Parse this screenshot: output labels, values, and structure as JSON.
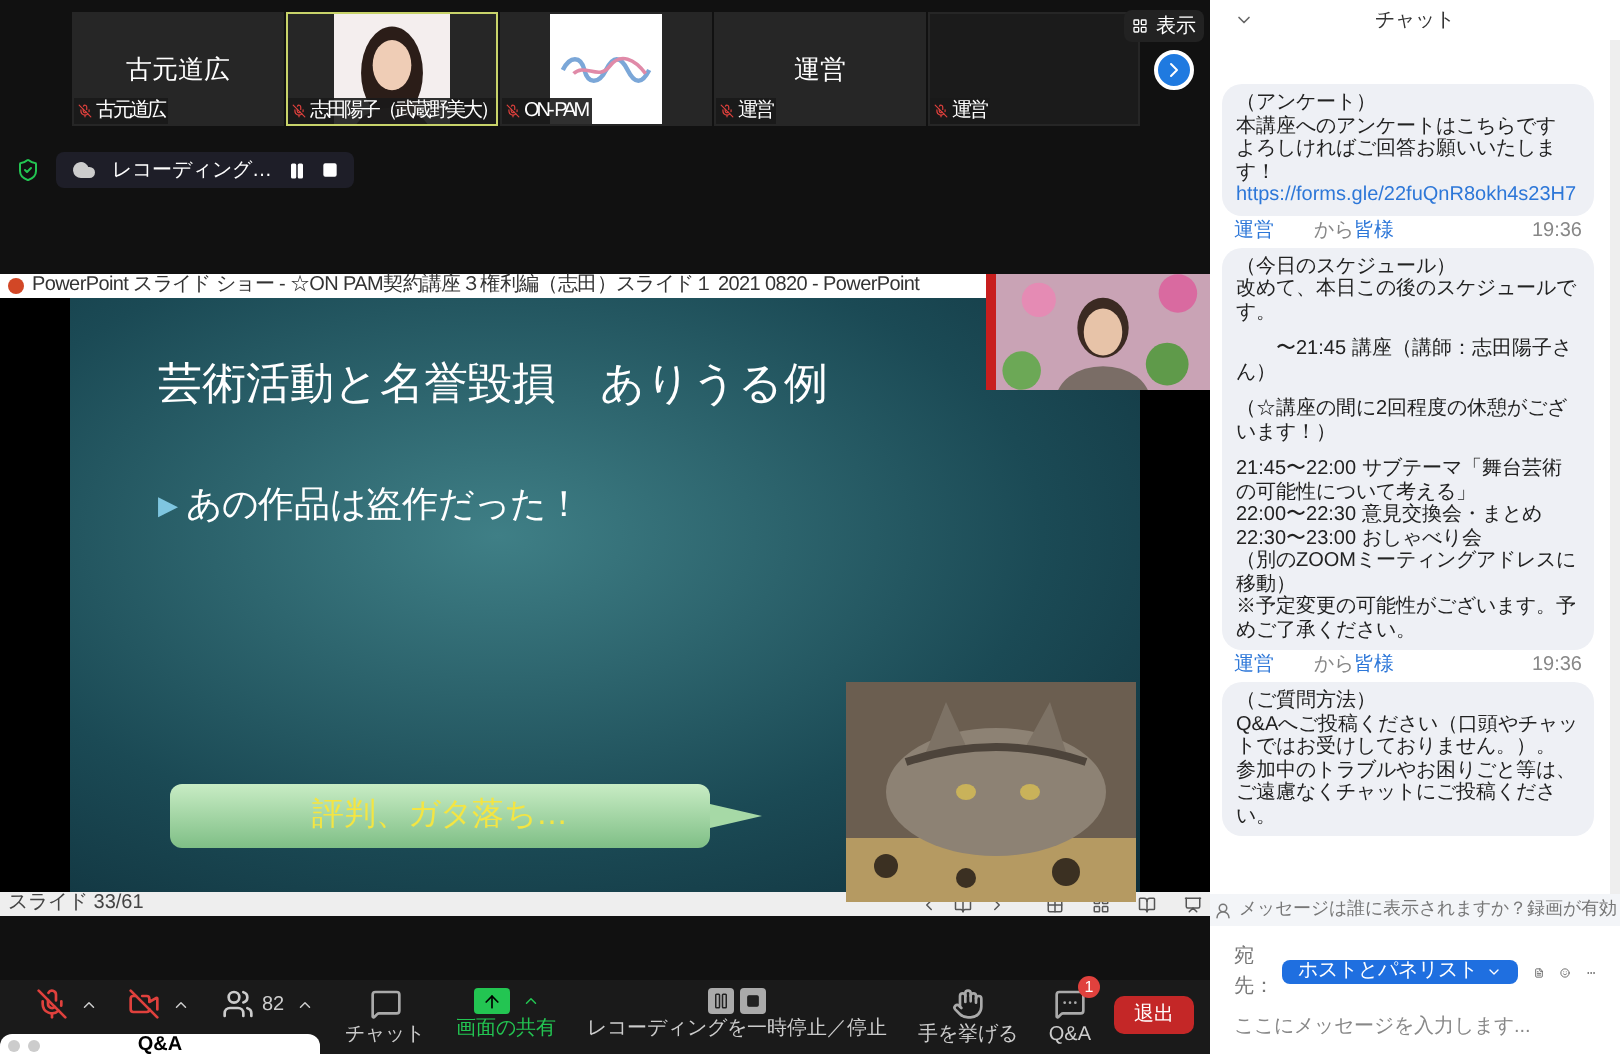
{
  "tiles": [
    {
      "kind": "text",
      "display": "古元道広",
      "name": "古元道広",
      "active": false
    },
    {
      "kind": "picture",
      "name": "志田陽子（武蔵野美大）",
      "active": true
    },
    {
      "kind": "logo",
      "name": "ON- PAM",
      "active": false
    },
    {
      "kind": "text",
      "display": "運営",
      "name": "運営",
      "active": false
    },
    {
      "kind": "blank",
      "name": "運営",
      "active": false
    }
  ],
  "view_button": "表示",
  "recording": {
    "label": "レコーディング…"
  },
  "presentation": {
    "window_title": "PowerPoint スライド ショー - ☆ON PAM契約講座３権利編（志田）スライド１ 2021 0820 - PowerPoint",
    "slide_title": "芸術活動と名誉毀損　ありうる例",
    "bullet_marker": "▶",
    "bullet": "あの作品は盗作だった！",
    "callout": "評判、ガタ落ち…",
    "status": "スライド 33/61"
  },
  "toolbar": [
    {
      "kind": "mic",
      "muted": true
    },
    {
      "kind": "video",
      "muted": true
    },
    {
      "kind": "participants",
      "count": "82"
    },
    {
      "kind": "chat",
      "label": "チャット"
    },
    {
      "kind": "share",
      "label": "画面の共有"
    },
    {
      "kind": "recording",
      "label": "レコーディングを一時停止／停止"
    },
    {
      "kind": "hand",
      "label": "手を挙げる"
    },
    {
      "kind": "qa",
      "label": "Q&A",
      "badge": "1"
    }
  ],
  "leave_button": "退出",
  "qa_window": {
    "title": "Q&A"
  },
  "chat": {
    "title": "チャット",
    "messages": [
      {
        "blocks": [
          [
            "（アンケート）",
            "本講座へのアンケートはこちらです",
            "よろしければご回答お願いいたします！"
          ]
        ],
        "link": "https://forms.gle/22fuQnR8okh4s23H7"
      },
      {
        "from": "運営",
        "via": "から",
        "to": "皆様",
        "time": "19:36",
        "blocks": [
          [
            "（今日のスケジュール）",
            "改めて、本日この後のスケジュールです。"
          ],
          [
            "　　〜21:45 講座（講師：志田陽子さん）"
          ],
          [
            "（☆講座の間に2回程度の休憩がございます！）"
          ],
          [
            "21:45〜22:00 サブテーマ「舞台芸術の可能性について考える」",
            "22:00〜22:30 意見交換会・まとめ",
            "22:30〜23:00 おしゃべり会",
            "（別のZOOMミーティングアドレスに移動）",
            "※予定変更の可能性がございます。予めご了承ください。"
          ]
        ]
      },
      {
        "from": "運営",
        "via": "から",
        "to": "皆様",
        "time": "19:36",
        "blocks": [
          [
            "（ご質問方法）",
            "Q&Aへご投稿ください（口頭やチャットではお受けしておりません。）。",
            "参加中のトラブルやお困りごと等は、ご遠慮なくチャットにご投稿ください。"
          ]
        ]
      }
    ],
    "notice": "メッセージは誰に表示されますか？録画が有効",
    "recipient_label": "宛先：",
    "recipient": "ホストとパネリスト",
    "input_placeholder": "ここにメッセージを入力します..."
  }
}
